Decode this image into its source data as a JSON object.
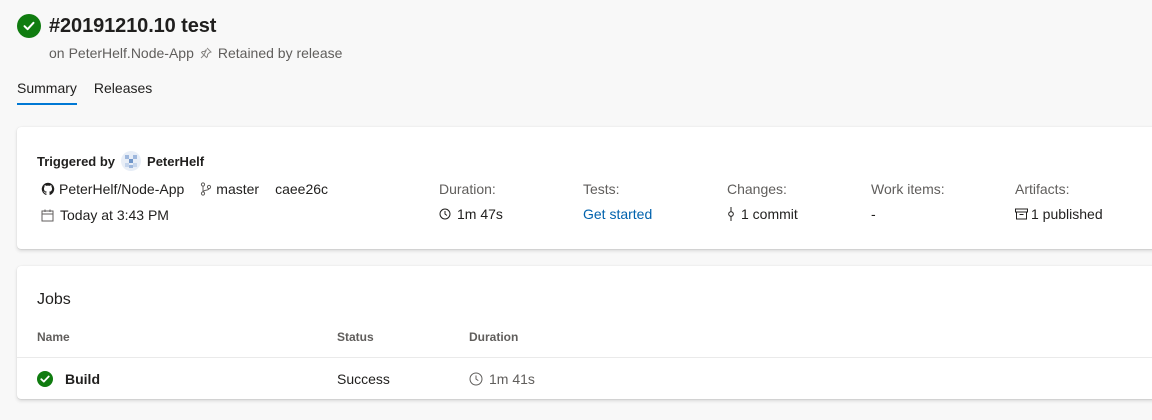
{
  "header": {
    "title": "#20191210.10 test",
    "subtitle_prefix": "on",
    "repo": "PeterHelf.Node-App",
    "retained": "Retained by release"
  },
  "tabs": [
    {
      "label": "Summary",
      "active": true
    },
    {
      "label": "Releases",
      "active": false
    }
  ],
  "summary": {
    "triggered_label": "Triggered by",
    "triggered_user": "PeterHelf",
    "repo_name": "PeterHelf/Node-App",
    "branch": "master",
    "commit": "caee26c",
    "time": "Today at 3:43 PM",
    "stats": [
      {
        "label": "Duration:",
        "value": "1m 47s",
        "icon": "clock-icon"
      },
      {
        "label": "Tests:",
        "value": "Get started",
        "link": true
      },
      {
        "label": "Changes:",
        "value": "1 commit",
        "icon": "commit-icon"
      },
      {
        "label": "Work items:",
        "value": "-"
      },
      {
        "label": "Artifacts:",
        "value": "1 published",
        "icon": "artifact-icon"
      }
    ]
  },
  "jobs": {
    "title": "Jobs",
    "columns": [
      "Name",
      "Status",
      "Duration"
    ],
    "rows": [
      {
        "name": "Build",
        "status": "Success",
        "duration": "1m 41s"
      }
    ]
  },
  "colors": {
    "success": "#107c10",
    "accent": "#0078d4",
    "link": "#0062ad"
  }
}
